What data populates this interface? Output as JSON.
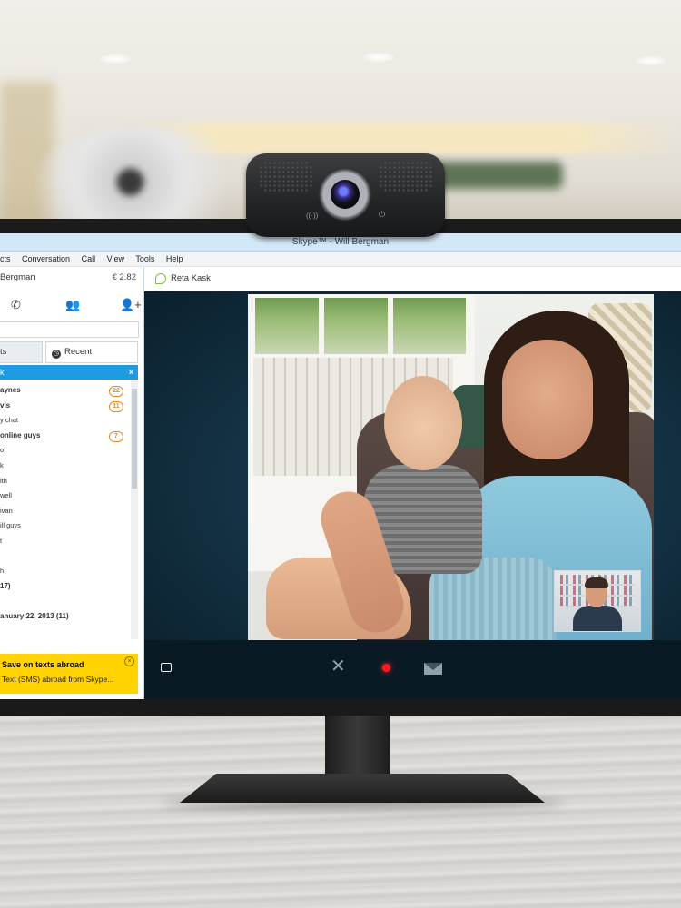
{
  "window": {
    "title": "Skype™ - Will Bergman"
  },
  "menu": [
    "cts",
    "Conversation",
    "Call",
    "View",
    "Tools",
    "Help"
  ],
  "account": {
    "name": "Bergman",
    "credit": "€ 2.82"
  },
  "tabs": {
    "contacts": "ts",
    "recent": "Recent"
  },
  "selected_item": "k",
  "contact_list": [
    {
      "label": "aynes",
      "bold": true,
      "badge": "22"
    },
    {
      "label": "vis",
      "bold": true,
      "badge": "11"
    },
    {
      "label": "y chat",
      "bold": false,
      "badge": ""
    },
    {
      "label": "online guys",
      "bold": true,
      "badge": "7"
    },
    {
      "label": "o",
      "bold": false,
      "badge": ""
    },
    {
      "label": "k",
      "bold": false,
      "badge": ""
    },
    {
      "label": "ith",
      "bold": false,
      "badge": ""
    },
    {
      "label": "well",
      "bold": false,
      "badge": ""
    },
    {
      "label": "ivan",
      "bold": false,
      "badge": ""
    },
    {
      "label": "ill guys",
      "bold": false,
      "badge": ""
    },
    {
      "label": "t",
      "bold": false,
      "badge": ""
    },
    {
      "label": "",
      "bold": false,
      "badge": ""
    },
    {
      "label": "h",
      "bold": false,
      "badge": ""
    },
    {
      "label": "17)",
      "bold": true,
      "badge": ""
    },
    {
      "label": "",
      "bold": false,
      "badge": ""
    },
    {
      "label": "anuary 22, 2013 (11)",
      "bold": true,
      "badge": ""
    },
    {
      "label": "",
      "bold": false,
      "badge": ""
    }
  ],
  "promo": {
    "title": "Save on texts abroad",
    "text": "Text (SMS) abroad from Skype..."
  },
  "conversation": {
    "contact_name": "Reta Kask"
  },
  "icons": {
    "call": "phone-icon",
    "group": "group-icon",
    "add_contact": "add-contact-icon",
    "recent": "clock-icon",
    "video": "video-icon",
    "hangup": "hangup-icon",
    "record": "record-icon",
    "message": "mail-icon"
  },
  "colors": {
    "selection": "#1e9be0",
    "promo": "#ffd200",
    "record": "#ff1a1a",
    "online": "#7fbf3a"
  }
}
